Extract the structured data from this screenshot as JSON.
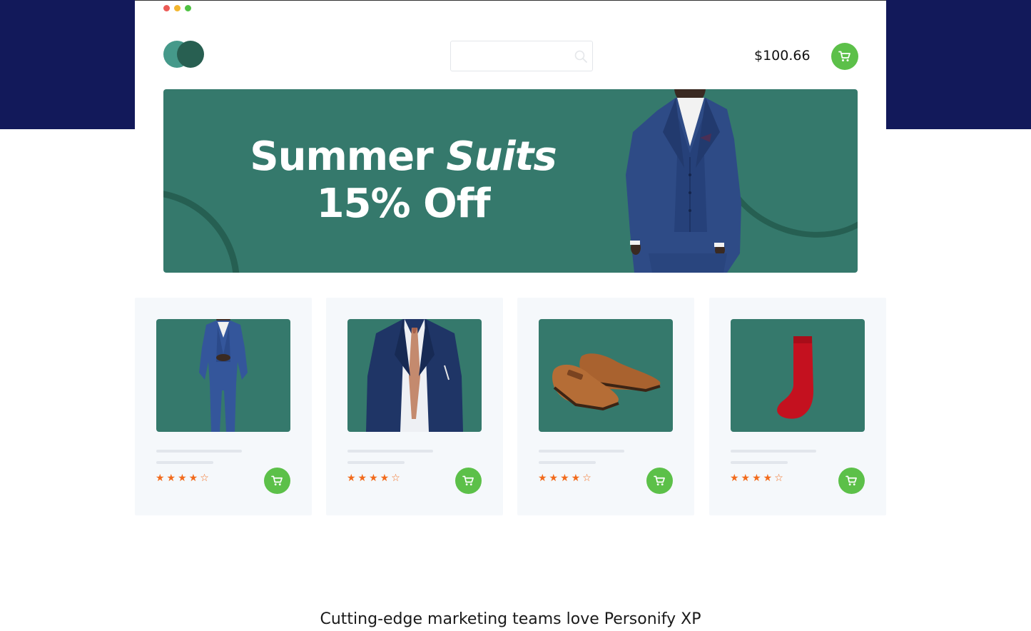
{
  "header": {
    "search_placeholder": "",
    "cart_total": "$100.66"
  },
  "banner": {
    "title_regular": "Summer",
    "title_italic": "Suits",
    "subtitle": "15% Off"
  },
  "products": [
    {
      "image": "blue three-piece suit",
      "rating": 4,
      "rating_max": 5,
      "stars": "★★★★☆"
    },
    {
      "image": "navy suit jacket with paisley tie",
      "rating": 4,
      "rating_max": 5,
      "stars": "★★★★☆"
    },
    {
      "image": "brown monk strap shoes",
      "rating": 4,
      "rating_max": 5,
      "stars": "★★★★☆"
    },
    {
      "image": "red dress sock",
      "rating": 4,
      "rating_max": 5,
      "stars": "★★★★☆"
    }
  ],
  "footer": {
    "tagline": "Cutting-edge marketing teams love Personify XP"
  },
  "colors": {
    "background_band": "#12195a",
    "banner": "#35796c",
    "accent_dark": "#265f52",
    "cart_button": "#5cc049",
    "star": "#f26b1d",
    "card_bg": "#f5f8fb"
  },
  "icons": {
    "cart": "cart-icon",
    "search": "search-icon"
  }
}
